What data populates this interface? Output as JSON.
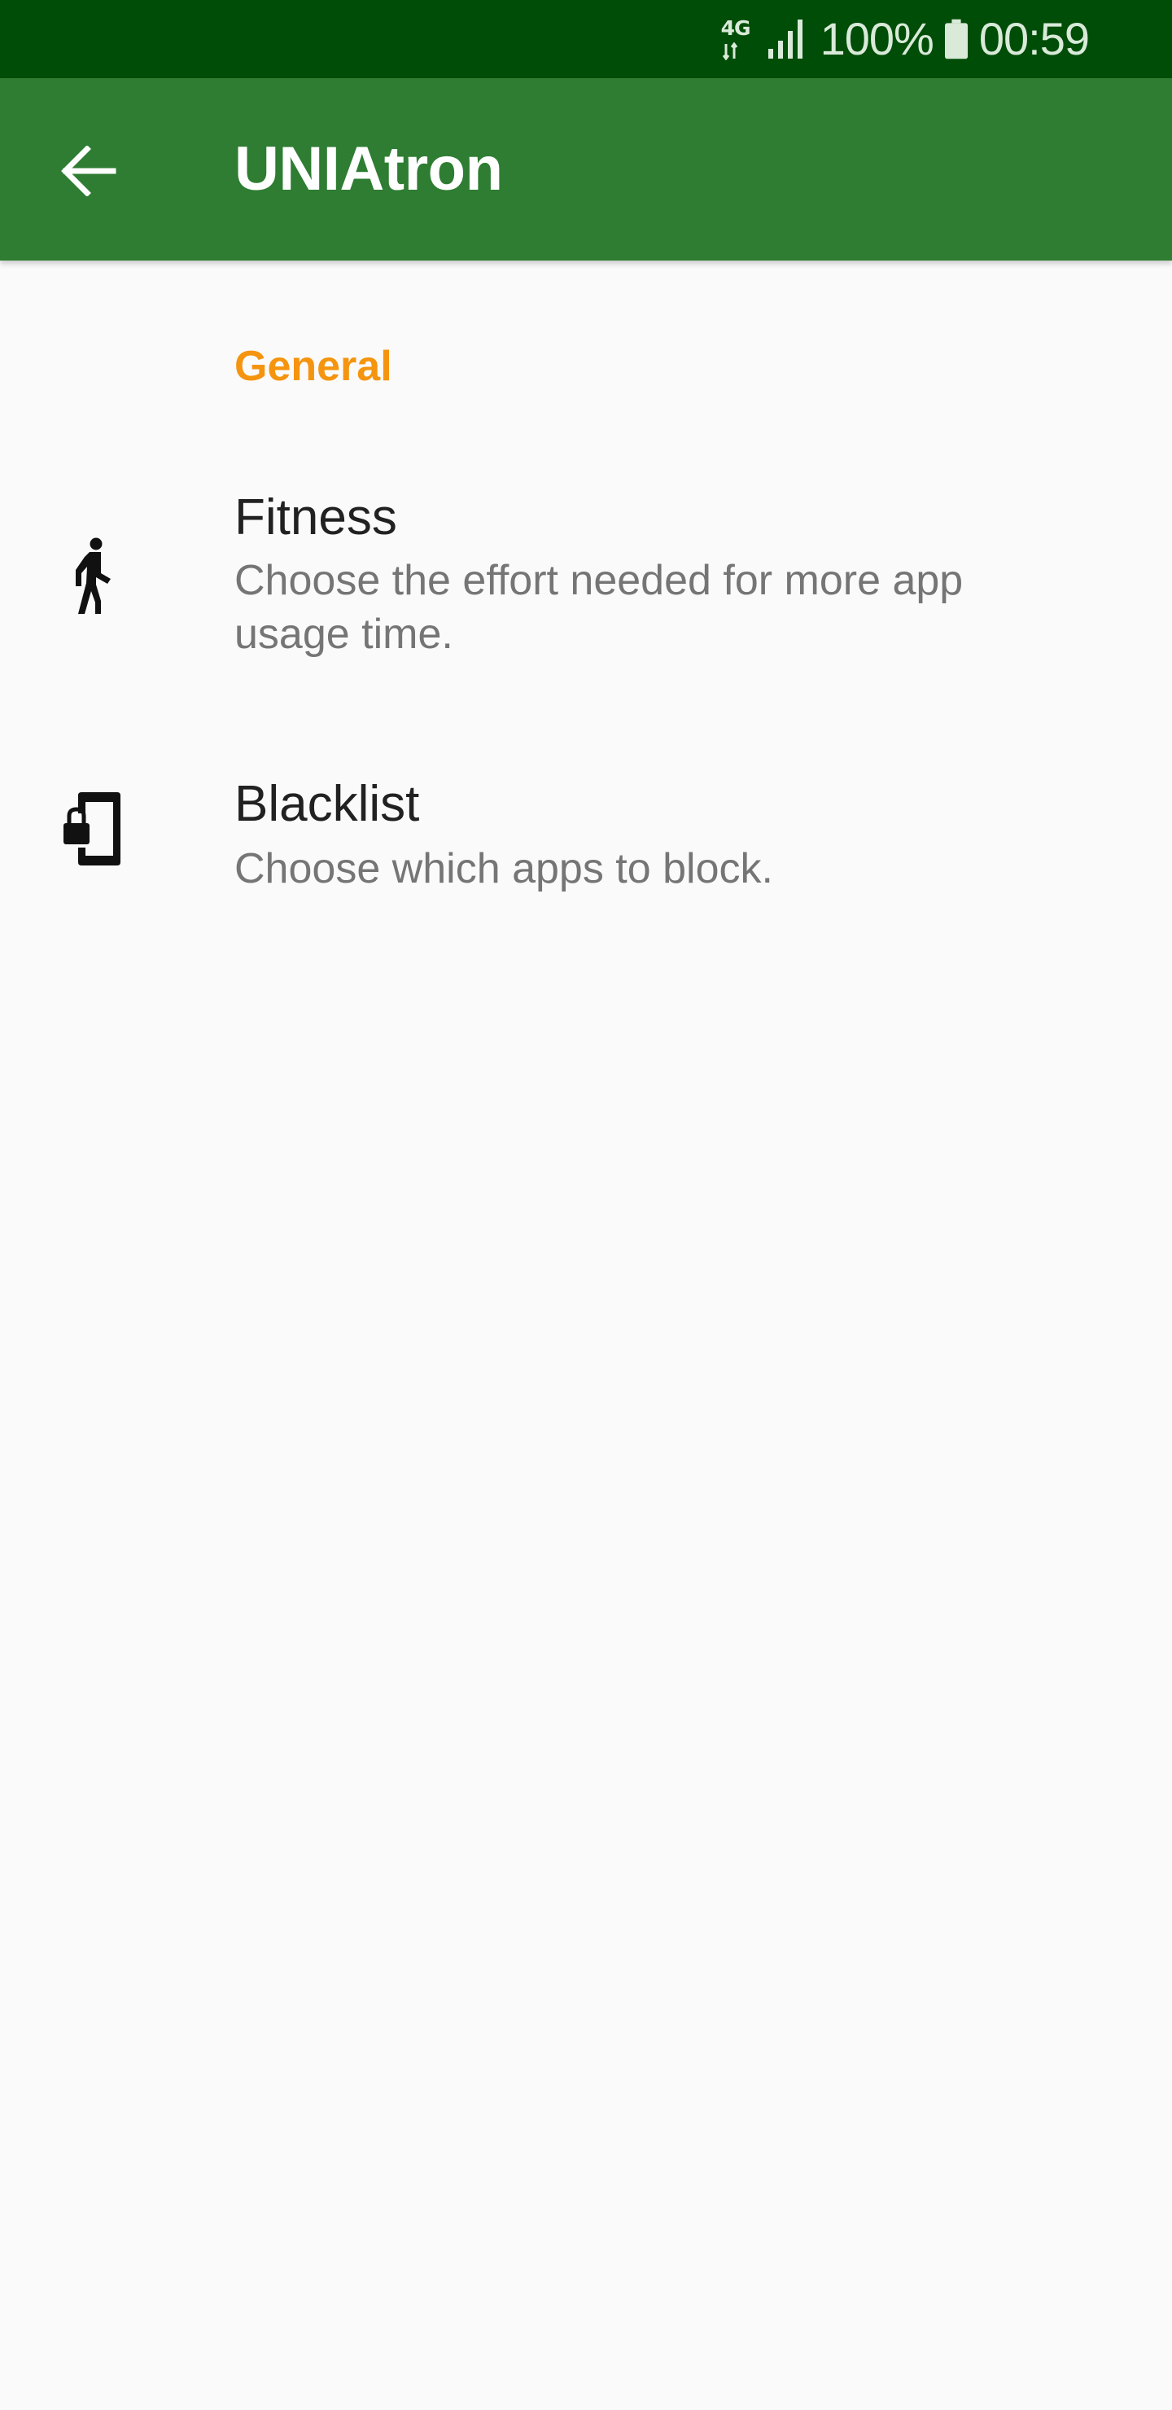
{
  "status_bar": {
    "network_type": "4G",
    "battery_percent": "100%",
    "time": "00:59",
    "icons": [
      "network-4g-icon",
      "signal-icon",
      "battery-icon"
    ]
  },
  "app_bar": {
    "title": "UNIAtron",
    "back_icon": "arrow-back-icon",
    "color": "#2e7d32"
  },
  "settings": {
    "section_header": "General",
    "section_header_color": "#f5940e",
    "items": [
      {
        "title": "Fitness",
        "summary": "Choose the effort needed for more app usage time.",
        "icon": "walking-person-icon"
      },
      {
        "title": "Blacklist",
        "summary": "Choose which apps to block.",
        "icon": "phone-lock-icon"
      }
    ]
  }
}
